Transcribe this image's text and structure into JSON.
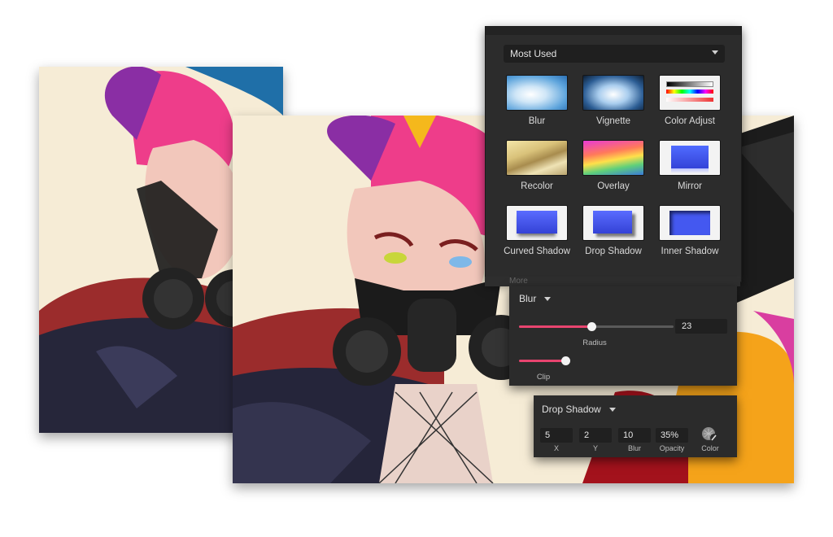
{
  "effects_panel": {
    "category": "Most Used",
    "effects": [
      {
        "label": "Blur"
      },
      {
        "label": "Vignette"
      },
      {
        "label": "Color Adjust"
      },
      {
        "label": "Recolor"
      },
      {
        "label": "Overlay"
      },
      {
        "label": "Mirror"
      },
      {
        "label": "Curved Shadow"
      },
      {
        "label": "Drop Shadow"
      },
      {
        "label": "Inner Shadow"
      }
    ],
    "more_label": "More"
  },
  "blur_panel": {
    "title": "Blur",
    "radius_label": "Radius",
    "radius_value": "23",
    "radius_fraction": 0.47,
    "clip_label": "Clip",
    "clip_on": true
  },
  "shadow_panel": {
    "title": "Drop Shadow",
    "fields": [
      {
        "value": "5",
        "label": "X"
      },
      {
        "value": "2",
        "label": "Y"
      },
      {
        "value": "10",
        "label": "Blur"
      },
      {
        "value": "35%",
        "label": "Opacity"
      }
    ],
    "color_label": "Color"
  },
  "colors": {
    "accent": "#e8446f",
    "panel_bg": "#2c2c2c",
    "field_bg": "#202020"
  }
}
